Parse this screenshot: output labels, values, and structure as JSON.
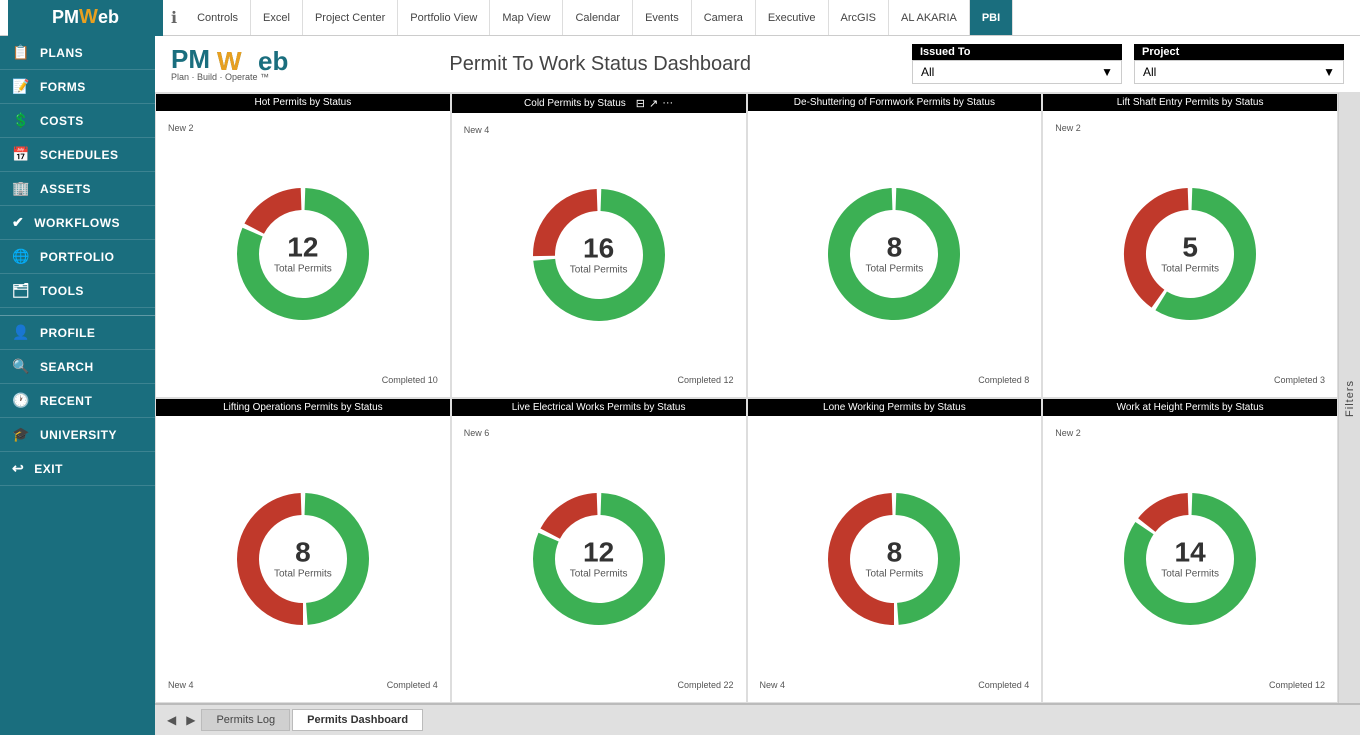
{
  "nav": {
    "tabs": [
      {
        "label": "Controls",
        "active": false
      },
      {
        "label": "Excel",
        "active": false
      },
      {
        "label": "Project Center",
        "active": false
      },
      {
        "label": "Portfolio View",
        "active": false
      },
      {
        "label": "Map View",
        "active": false
      },
      {
        "label": "Calendar",
        "active": false
      },
      {
        "label": "Events",
        "active": false
      },
      {
        "label": "Camera",
        "active": false
      },
      {
        "label": "Executive",
        "active": false
      },
      {
        "label": "ArcGIS",
        "active": false
      },
      {
        "label": "AL AKARIA",
        "active": false
      },
      {
        "label": "PBI",
        "active": true
      }
    ]
  },
  "sidebar": {
    "items": [
      {
        "label": "PLANS",
        "icon": "📋"
      },
      {
        "label": "FORMS",
        "icon": "📝"
      },
      {
        "label": "COSTS",
        "icon": "💲"
      },
      {
        "label": "SCHEDULES",
        "icon": "📅"
      },
      {
        "label": "ASSETS",
        "icon": "🏢"
      },
      {
        "label": "WORKFLOWS",
        "icon": "✔"
      },
      {
        "label": "PORTFOLIO",
        "icon": "🌐"
      },
      {
        "label": "TOOLS",
        "icon": "🗂"
      },
      {
        "label": "PROFILE",
        "icon": "👤"
      },
      {
        "label": "SEARCH",
        "icon": "🔍"
      },
      {
        "label": "RECENT",
        "icon": "🕐"
      },
      {
        "label": "UNIVERSITY",
        "icon": "🎓"
      },
      {
        "label": "EXIT",
        "icon": "↩"
      }
    ]
  },
  "header": {
    "logo_text": "PM",
    "logo_accent": "Web",
    "tagline": "Plan · Build · Operate ™",
    "title": "Permit To Work Status Dashboard"
  },
  "filters": {
    "issued_to": {
      "label": "Issued To",
      "value": "All"
    },
    "project": {
      "label": "Project",
      "value": "All"
    }
  },
  "charts": [
    {
      "title": "Hot Permits by Status",
      "total": 12,
      "total_label": "Total Permits",
      "green_pct": 83,
      "red_pct": 17,
      "annotations": [
        {
          "text": "New 2",
          "position": "top-left"
        },
        {
          "text": "Completed 10",
          "position": "bottom-right"
        }
      ],
      "show_icons": false
    },
    {
      "title": "Cold Permits by Status",
      "total": 16,
      "total_label": "Total Permits",
      "green_pct": 75,
      "red_pct": 25,
      "annotations": [
        {
          "text": "New 4",
          "position": "top-left"
        },
        {
          "text": "Completed 12",
          "position": "bottom-right"
        }
      ],
      "show_icons": true
    },
    {
      "title": "De-Shuttering of Formwork Permits by Status",
      "total": 8,
      "total_label": "Total Permits",
      "green_pct": 100,
      "red_pct": 0,
      "annotations": [
        {
          "text": "Completed 8",
          "position": "bottom-right"
        }
      ],
      "show_icons": false
    },
    {
      "title": "Lift Shaft Entry Permits by Status",
      "total": 5,
      "total_label": "Total Permits",
      "green_pct": 60,
      "red_pct": 40,
      "annotations": [
        {
          "text": "New 2",
          "position": "top-left"
        },
        {
          "text": "Completed 3",
          "position": "bottom-right"
        }
      ],
      "show_icons": false
    },
    {
      "title": "Lifting Operations Permits by Status",
      "total": 8,
      "total_label": "Total Permits",
      "green_pct": 50,
      "red_pct": 50,
      "annotations": [
        {
          "text": "New 4",
          "position": "bottom-left"
        },
        {
          "text": "Completed 4",
          "position": "bottom-right"
        }
      ],
      "show_icons": false
    },
    {
      "title": "Live Electrical Works Permits by Status",
      "total": 12,
      "total_label": "Total Permits",
      "green_pct": 83,
      "red_pct": 17,
      "annotations": [
        {
          "text": "New 6",
          "position": "top-left"
        },
        {
          "text": "Completed 22",
          "position": "bottom-right"
        }
      ],
      "show_icons": false
    },
    {
      "title": "Lone Working Permits by Status",
      "total": 8,
      "total_label": "Total Permits",
      "green_pct": 50,
      "red_pct": 50,
      "annotations": [
        {
          "text": "New 4",
          "position": "bottom-left"
        },
        {
          "text": "Completed 4",
          "position": "bottom-right"
        }
      ],
      "show_icons": false
    },
    {
      "title": "Work at Height Permits by Status",
      "total": 14,
      "total_label": "Total Permits",
      "green_pct": 86,
      "red_pct": 14,
      "annotations": [
        {
          "text": "New 2",
          "position": "top-left"
        },
        {
          "text": "Completed 12",
          "position": "bottom-right"
        }
      ],
      "show_icons": false
    }
  ],
  "bottom_tabs": [
    {
      "label": "Permits Log",
      "active": false
    },
    {
      "label": "Permits Dashboard",
      "active": true
    }
  ],
  "colors": {
    "green": "#2ecc40",
    "red": "#c0392b",
    "sidebar_bg": "#1a6e7e",
    "header_bg": "#000000",
    "accent": "#e8a020"
  }
}
